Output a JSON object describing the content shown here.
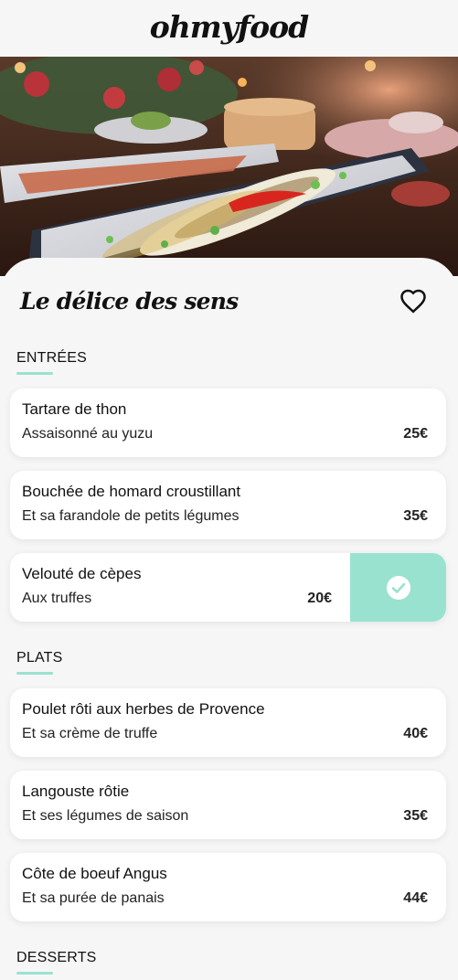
{
  "header": {
    "logo": "ohmyfood"
  },
  "restaurant": {
    "title": "Le délice des sens"
  },
  "sections": [
    {
      "title": "ENTRÉES",
      "dishes": [
        {
          "name": "Tartare de thon",
          "description": "Assaisonné au yuzu",
          "price": "25€"
        },
        {
          "name": "Bouchée de homard croustillant",
          "description": "Et sa farandole de petits légumes",
          "price": "35€"
        },
        {
          "name": "Velouté de cèpes",
          "description": "Aux truffes",
          "price": "20€",
          "selected": true
        }
      ]
    },
    {
      "title": "PLATS",
      "dishes": [
        {
          "name": "Poulet rôti aux herbes de Provence",
          "description": "Et sa crème de truffe",
          "price": "40€"
        },
        {
          "name": "Langouste rôtie",
          "description": "Et ses légumes de saison",
          "price": "35€"
        },
        {
          "name": "Côte de boeuf Angus",
          "description": "Et sa purée de panais",
          "price": "44€"
        }
      ]
    },
    {
      "title": "DESSERTS",
      "dishes": []
    }
  ],
  "colors": {
    "accent": "#99e2d0",
    "background": "#f6f6f6",
    "card": "#ffffff"
  },
  "icons": {
    "favorite": "heart-outline-icon",
    "selected": "check-circle-icon"
  }
}
